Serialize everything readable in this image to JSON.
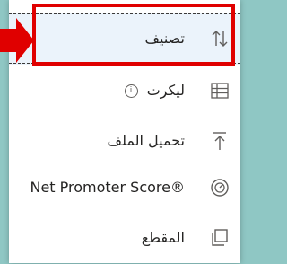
{
  "menu": {
    "items": [
      {
        "label": "تصنيف",
        "icon": "sort-arrows-icon",
        "selected": true
      },
      {
        "label": "ليكرت",
        "icon": "table-grid-icon",
        "info": "i"
      },
      {
        "label": "تحميل الملف",
        "icon": "upload-arrow-icon"
      },
      {
        "label": "Net Promoter Score®",
        "icon": "gauge-icon"
      },
      {
        "label": "المقطع",
        "icon": "copy-pages-icon"
      }
    ]
  },
  "annotation": {
    "highlight_color": "#e00000",
    "arrow_color": "#e00000"
  },
  "colors": {
    "background": "#8fc7c4",
    "menu_bg": "#ffffff",
    "selected_bg": "#ebf3fb",
    "text": "#252423",
    "icon": "#605e5c"
  }
}
